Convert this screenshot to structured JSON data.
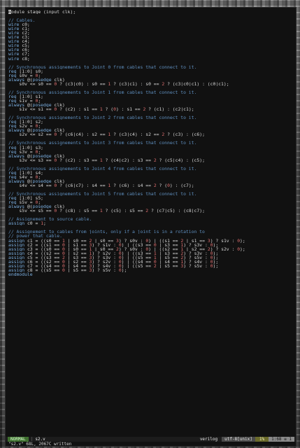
{
  "editor": {
    "lines": [
      [
        {
          "c": "cursor",
          "t": "m"
        },
        {
          "c": "text",
          "t": "odule stage (input clk);"
        }
      ],
      [],
      [
        {
          "c": "comment",
          "t": "// Cables."
        }
      ],
      [
        {
          "c": "keyword",
          "t": "wire"
        },
        {
          "c": "text",
          "t": " c0;"
        }
      ],
      [
        {
          "c": "keyword",
          "t": "wire"
        },
        {
          "c": "text",
          "t": " c1;"
        }
      ],
      [
        {
          "c": "keyword",
          "t": "wire"
        },
        {
          "c": "text",
          "t": " c2;"
        }
      ],
      [
        {
          "c": "keyword",
          "t": "wire"
        },
        {
          "c": "text",
          "t": " c3;"
        }
      ],
      [
        {
          "c": "keyword",
          "t": "wire"
        },
        {
          "c": "text",
          "t": " c4;"
        }
      ],
      [
        {
          "c": "keyword",
          "t": "wire"
        },
        {
          "c": "text",
          "t": " c5;"
        }
      ],
      [
        {
          "c": "keyword",
          "t": "wire"
        },
        {
          "c": "text",
          "t": " c6;"
        }
      ],
      [
        {
          "c": "keyword",
          "t": "wire"
        },
        {
          "c": "text",
          "t": " c7;"
        }
      ],
      [
        {
          "c": "keyword",
          "t": "wire"
        },
        {
          "c": "text",
          "t": " c8;"
        }
      ],
      [],
      [
        {
          "c": "comment",
          "t": "// Synchronous assignements to Joint 0 from cables that connect to it."
        }
      ],
      [
        {
          "c": "keyword",
          "t": "reg"
        },
        {
          "c": "text",
          "t": " [1:0] s0;"
        }
      ],
      [
        {
          "c": "keyword",
          "t": "reg"
        },
        {
          "c": "text",
          "t": " s0v = "
        },
        {
          "c": "number",
          "t": "0"
        },
        {
          "c": "text",
          "t": ";"
        }
      ],
      [
        {
          "c": "keyword",
          "t": "always"
        },
        {
          "c": "text",
          "t": " @("
        },
        {
          "c": "keyword",
          "t": "posedge"
        },
        {
          "c": "text",
          "t": " clk)"
        }
      ],
      [
        {
          "c": "text",
          "t": "    s0v <= s0 == "
        },
        {
          "c": "number",
          "t": "0"
        },
        {
          "c": "text",
          "t": " ? (c3|c0) : s0 == "
        },
        {
          "c": "number",
          "t": "1"
        },
        {
          "c": "text",
          "t": " ? (c3|c1) : s0 == "
        },
        {
          "c": "number",
          "t": "2"
        },
        {
          "c": "text",
          "t": " ? (c3|c0|c1) : (c0|c1);"
        }
      ],
      [],
      [
        {
          "c": "comment",
          "t": "// Synchronous assignements to Joint 1 from cables that connect to it."
        }
      ],
      [
        {
          "c": "keyword",
          "t": "reg"
        },
        {
          "c": "text",
          "t": " [1:0] s1;"
        }
      ],
      [
        {
          "c": "keyword",
          "t": "reg"
        },
        {
          "c": "text",
          "t": " s1v = "
        },
        {
          "c": "number",
          "t": "0"
        },
        {
          "c": "text",
          "t": ";"
        }
      ],
      [
        {
          "c": "keyword",
          "t": "always"
        },
        {
          "c": "text",
          "t": " @("
        },
        {
          "c": "keyword",
          "t": "posedge"
        },
        {
          "c": "text",
          "t": " clk)"
        }
      ],
      [
        {
          "c": "text",
          "t": "    s1v <= s1 == "
        },
        {
          "c": "number",
          "t": "0"
        },
        {
          "c": "text",
          "t": " ? (c2) : s1 == "
        },
        {
          "c": "number",
          "t": "1"
        },
        {
          "c": "text",
          "t": " ? ("
        },
        {
          "c": "number",
          "t": "0"
        },
        {
          "c": "text",
          "t": ") : s1 == "
        },
        {
          "c": "number",
          "t": "2"
        },
        {
          "c": "text",
          "t": " ? (c1) : (c2|c1);"
        }
      ],
      [],
      [
        {
          "c": "comment",
          "t": "// Synchronous assignements to Joint 2 from cables that connect to it."
        }
      ],
      [
        {
          "c": "keyword",
          "t": "reg"
        },
        {
          "c": "text",
          "t": " [1:0] s2;"
        }
      ],
      [
        {
          "c": "keyword",
          "t": "reg"
        },
        {
          "c": "text",
          "t": " s2v = "
        },
        {
          "c": "number",
          "t": "0"
        },
        {
          "c": "text",
          "t": ";"
        }
      ],
      [
        {
          "c": "keyword",
          "t": "always"
        },
        {
          "c": "text",
          "t": " @("
        },
        {
          "c": "keyword",
          "t": "posedge"
        },
        {
          "c": "text",
          "t": " clk)"
        }
      ],
      [
        {
          "c": "text",
          "t": "    s2v <= s2 == "
        },
        {
          "c": "number",
          "t": "0"
        },
        {
          "c": "text",
          "t": " ? (c6|c4) : s2 == "
        },
        {
          "c": "number",
          "t": "1"
        },
        {
          "c": "text",
          "t": " ? (c3|c4) : s2 == "
        },
        {
          "c": "number",
          "t": "2"
        },
        {
          "c": "text",
          "t": " ? (c3) : (c6);"
        }
      ],
      [],
      [
        {
          "c": "comment",
          "t": "// Synchronous assignements to Joint 3 from cables that connect to it."
        }
      ],
      [
        {
          "c": "keyword",
          "t": "reg"
        },
        {
          "c": "text",
          "t": " [1:0] s3;"
        }
      ],
      [
        {
          "c": "keyword",
          "t": "reg"
        },
        {
          "c": "text",
          "t": " s3v = "
        },
        {
          "c": "number",
          "t": "0"
        },
        {
          "c": "text",
          "t": ";"
        }
      ],
      [
        {
          "c": "keyword",
          "t": "always"
        },
        {
          "c": "text",
          "t": " @("
        },
        {
          "c": "keyword",
          "t": "posedge"
        },
        {
          "c": "text",
          "t": " clk)"
        }
      ],
      [
        {
          "c": "text",
          "t": "    s3v <= s3 == "
        },
        {
          "c": "number",
          "t": "0"
        },
        {
          "c": "text",
          "t": " ? (c2) : s3 == "
        },
        {
          "c": "number",
          "t": "1"
        },
        {
          "c": "text",
          "t": " ? (c4|c2) : s3 == "
        },
        {
          "c": "number",
          "t": "2"
        },
        {
          "c": "text",
          "t": " ? (c5|c4) : (c5);"
        }
      ],
      [],
      [
        {
          "c": "comment",
          "t": "// Synchronous assignements to Joint 4 from cables that connect to it."
        }
      ],
      [
        {
          "c": "keyword",
          "t": "reg"
        },
        {
          "c": "text",
          "t": " [1:0] s4;"
        }
      ],
      [
        {
          "c": "keyword",
          "t": "reg"
        },
        {
          "c": "text",
          "t": " s4v = "
        },
        {
          "c": "number",
          "t": "0"
        },
        {
          "c": "text",
          "t": ";"
        }
      ],
      [
        {
          "c": "keyword",
          "t": "always"
        },
        {
          "c": "text",
          "t": " @("
        },
        {
          "c": "keyword",
          "t": "posedge"
        },
        {
          "c": "text",
          "t": " clk)"
        }
      ],
      [
        {
          "c": "text",
          "t": "    s4v <= s4 == "
        },
        {
          "c": "number",
          "t": "0"
        },
        {
          "c": "text",
          "t": " ? (c6|c7) : s4 == "
        },
        {
          "c": "number",
          "t": "1"
        },
        {
          "c": "text",
          "t": " ? (c6) : s4 == "
        },
        {
          "c": "number",
          "t": "2"
        },
        {
          "c": "text",
          "t": " ? ("
        },
        {
          "c": "number",
          "t": "0"
        },
        {
          "c": "text",
          "t": ") : (c7);"
        }
      ],
      [],
      [
        {
          "c": "comment",
          "t": "// Synchronous assignements to Joint 5 from cables that connect to it."
        }
      ],
      [
        {
          "c": "keyword",
          "t": "reg"
        },
        {
          "c": "text",
          "t": " [1:0] s5;"
        }
      ],
      [
        {
          "c": "keyword",
          "t": "reg"
        },
        {
          "c": "text",
          "t": " s5v = "
        },
        {
          "c": "number",
          "t": "0"
        },
        {
          "c": "text",
          "t": ";"
        }
      ],
      [
        {
          "c": "keyword",
          "t": "always"
        },
        {
          "c": "text",
          "t": " @("
        },
        {
          "c": "keyword",
          "t": "posedge"
        },
        {
          "c": "text",
          "t": " clk)"
        }
      ],
      [
        {
          "c": "text",
          "t": "    s5v <= s5 == "
        },
        {
          "c": "number",
          "t": "0"
        },
        {
          "c": "text",
          "t": " ? (c8) : s5 == "
        },
        {
          "c": "number",
          "t": "1"
        },
        {
          "c": "text",
          "t": " ? (c5) : s5 == "
        },
        {
          "c": "number",
          "t": "2"
        },
        {
          "c": "text",
          "t": " ? (c7|c5) : (c8|c7);"
        }
      ],
      [],
      [
        {
          "c": "comment",
          "t": "// Assignement to source cable."
        }
      ],
      [
        {
          "c": "keyword",
          "t": "assign"
        },
        {
          "c": "text",
          "t": " c0 = "
        },
        {
          "c": "number",
          "t": "1"
        },
        {
          "c": "text",
          "t": ";"
        }
      ],
      [],
      [
        {
          "c": "comment",
          "t": "// Assignement to cables from joints, only if a joint is in a rotation to"
        }
      ],
      [
        {
          "c": "comment",
          "t": "// power that cable."
        }
      ],
      [
        {
          "c": "keyword",
          "t": "assign"
        },
        {
          "c": "text",
          "t": " c1 = ((s0 == "
        },
        {
          "c": "number",
          "t": "1"
        },
        {
          "c": "text",
          "t": " | s0 == "
        },
        {
          "c": "number",
          "t": "2"
        },
        {
          "c": "text",
          "t": " | s0 == "
        },
        {
          "c": "number",
          "t": "3"
        },
        {
          "c": "text",
          "t": ") ? s0v : "
        },
        {
          "c": "number",
          "t": "0"
        },
        {
          "c": "text",
          "t": ") | ((s1 == "
        },
        {
          "c": "number",
          "t": "2"
        },
        {
          "c": "text",
          "t": " | s1 == "
        },
        {
          "c": "number",
          "t": "3"
        },
        {
          "c": "text",
          "t": ") ? s1v : "
        },
        {
          "c": "number",
          "t": "0"
        },
        {
          "c": "text",
          "t": ");"
        }
      ],
      [
        {
          "c": "keyword",
          "t": "assign"
        },
        {
          "c": "text",
          "t": " c2 = ((s1 == "
        },
        {
          "c": "number",
          "t": "0"
        },
        {
          "c": "text",
          "t": " | s1 == "
        },
        {
          "c": "number",
          "t": "3"
        },
        {
          "c": "text",
          "t": ") ? s1v : "
        },
        {
          "c": "number",
          "t": "0"
        },
        {
          "c": "text",
          "t": ") | ((s3 == "
        },
        {
          "c": "number",
          "t": "0"
        },
        {
          "c": "text",
          "t": " | s3 == "
        },
        {
          "c": "number",
          "t": "1"
        },
        {
          "c": "text",
          "t": ") ? s3v : "
        },
        {
          "c": "number",
          "t": "0"
        },
        {
          "c": "text",
          "t": ");"
        }
      ],
      [
        {
          "c": "keyword",
          "t": "assign"
        },
        {
          "c": "text",
          "t": " c3 = ((s0 == "
        },
        {
          "c": "number",
          "t": "0"
        },
        {
          "c": "text",
          "t": " | s0 == "
        },
        {
          "c": "number",
          "t": "1"
        },
        {
          "c": "text",
          "t": " | s0 == "
        },
        {
          "c": "number",
          "t": "2"
        },
        {
          "c": "text",
          "t": ") ? s0v : "
        },
        {
          "c": "number",
          "t": "0"
        },
        {
          "c": "text",
          "t": ") | ((s2 == "
        },
        {
          "c": "number",
          "t": "1"
        },
        {
          "c": "text",
          "t": " | s2 == "
        },
        {
          "c": "number",
          "t": "2"
        },
        {
          "c": "text",
          "t": ") ? s2v : "
        },
        {
          "c": "number",
          "t": "0"
        },
        {
          "c": "text",
          "t": ");"
        }
      ],
      [
        {
          "c": "keyword",
          "t": "assign"
        },
        {
          "c": "text",
          "t": " c4 = ((s2 == "
        },
        {
          "c": "number",
          "t": "0"
        },
        {
          "c": "text",
          "t": " | s2 == "
        },
        {
          "c": "number",
          "t": "1"
        },
        {
          "c": "text",
          "t": ") ? s2v : "
        },
        {
          "c": "number",
          "t": "0"
        },
        {
          "c": "text",
          "t": ") | ((s3 == "
        },
        {
          "c": "number",
          "t": "1"
        },
        {
          "c": "text",
          "t": " | s3 == "
        },
        {
          "c": "number",
          "t": "2"
        },
        {
          "c": "text",
          "t": ") ? s3v : "
        },
        {
          "c": "number",
          "t": "0"
        },
        {
          "c": "text",
          "t": ");"
        }
      ],
      [
        {
          "c": "keyword",
          "t": "assign"
        },
        {
          "c": "text",
          "t": " c5 = ((s3 == "
        },
        {
          "c": "number",
          "t": "2"
        },
        {
          "c": "text",
          "t": " | s3 == "
        },
        {
          "c": "number",
          "t": "3"
        },
        {
          "c": "text",
          "t": ") ? s3v : "
        },
        {
          "c": "number",
          "t": "0"
        },
        {
          "c": "text",
          "t": ") | ((s5 == "
        },
        {
          "c": "number",
          "t": "1"
        },
        {
          "c": "text",
          "t": " | s5 == "
        },
        {
          "c": "number",
          "t": "2"
        },
        {
          "c": "text",
          "t": ") ? s5v : "
        },
        {
          "c": "number",
          "t": "0"
        },
        {
          "c": "text",
          "t": ");"
        }
      ],
      [
        {
          "c": "keyword",
          "t": "assign"
        },
        {
          "c": "text",
          "t": " c6 = ((s2 == "
        },
        {
          "c": "number",
          "t": "0"
        },
        {
          "c": "text",
          "t": " | s2 == "
        },
        {
          "c": "number",
          "t": "3"
        },
        {
          "c": "text",
          "t": ") ? s2v : "
        },
        {
          "c": "number",
          "t": "0"
        },
        {
          "c": "text",
          "t": ") | ((s4 == "
        },
        {
          "c": "number",
          "t": "0"
        },
        {
          "c": "text",
          "t": " | s4 == "
        },
        {
          "c": "number",
          "t": "1"
        },
        {
          "c": "text",
          "t": ") ? s4v : "
        },
        {
          "c": "number",
          "t": "0"
        },
        {
          "c": "text",
          "t": ");"
        }
      ],
      [
        {
          "c": "keyword",
          "t": "assign"
        },
        {
          "c": "text",
          "t": " c7 = ((s4 == "
        },
        {
          "c": "number",
          "t": "0"
        },
        {
          "c": "text",
          "t": " | s4 == "
        },
        {
          "c": "number",
          "t": "3"
        },
        {
          "c": "text",
          "t": ") ? s4v : "
        },
        {
          "c": "number",
          "t": "0"
        },
        {
          "c": "text",
          "t": ") | ((s5 == "
        },
        {
          "c": "number",
          "t": "2"
        },
        {
          "c": "text",
          "t": " | s5 == "
        },
        {
          "c": "number",
          "t": "3"
        },
        {
          "c": "text",
          "t": ") ? s5v : "
        },
        {
          "c": "number",
          "t": "0"
        },
        {
          "c": "text",
          "t": ");"
        }
      ],
      [
        {
          "c": "keyword",
          "t": "assign"
        },
        {
          "c": "text",
          "t": " c8 = ((s5 == "
        },
        {
          "c": "number",
          "t": "0"
        },
        {
          "c": "text",
          "t": " | s5 == "
        },
        {
          "c": "number",
          "t": "3"
        },
        {
          "c": "text",
          "t": ") ? s5v : "
        },
        {
          "c": "number",
          "t": "0"
        },
        {
          "c": "text",
          "t": ");"
        }
      ],
      [
        {
          "c": "keyword",
          "t": "endmodule"
        }
      ]
    ]
  },
  "statusline": {
    "mode": "NORMAL",
    "separator": "|",
    "filename": "s2.v",
    "filetype": "verilog",
    "encoding": "utf-8[unix]",
    "percent": "1%",
    "position": "1:68 ≡ 1"
  },
  "cmdline": {
    "message": "\"s2.v\" 68L, 2067C written"
  },
  "colors": {
    "comment": "#5f8fbf",
    "keyword": "#7aaee0",
    "number": "#e07070",
    "text": "#d6d6d6",
    "mode_bg": "#3f6f2f"
  }
}
